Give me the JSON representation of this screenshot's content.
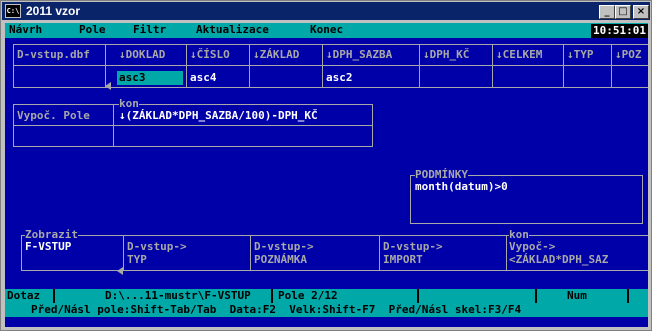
{
  "window": {
    "title": "2011 vzor",
    "icon_text": "C:\\"
  },
  "menu": [
    "Návrh",
    "Pole",
    "Filtr",
    "Aktualizace",
    "Konec"
  ],
  "clock": "10:51:01",
  "table": {
    "name": "D-vstup.dbf",
    "columns": [
      "↓DOKLAD",
      "↓ČÍSLO",
      "↓ZÁKLAD",
      "↓DPH_SAZBA",
      "↓DPH_KČ",
      "↓CELKEM",
      "↓TYP",
      "↓POZ"
    ],
    "values": [
      "asc3",
      "asc4",
      "",
      "asc2",
      "",
      "",
      "",
      ""
    ]
  },
  "calc": {
    "name": "Vypoč. Pole",
    "header": "kon",
    "expression": "↓(ZÁKLAD*DPH_SAZBA/100)-DPH_KČ"
  },
  "conditions": {
    "title": "PODMÍNKY",
    "expression": "month(datum)>0"
  },
  "view": {
    "title": "Zobrazit",
    "fields": [
      {
        "line1": "F-VSTUP",
        "line2": ""
      },
      {
        "line1": "D-vstup->",
        "line2": "TYP"
      },
      {
        "line1": "D-vstup->",
        "line2": "POZNÁMKA"
      },
      {
        "line1": "D-vstup->",
        "line2": "IMPORT"
      },
      {
        "line1": "Vypoč->",
        "line2": "<ZÁKLAD*DPH_SAZ",
        "header": "kon"
      }
    ]
  },
  "status": {
    "mode": "Dotaz",
    "path": "D:\\...11-mustr\\F-VSTUP",
    "field": "Pole 2/12",
    "indicator": "Num"
  },
  "hint": "Před/Násl pole:Shift-Tab/Tab  Data:F2  Velk:Shift-F7  Před/Násl skel:F3/F4",
  "colors": {
    "background": "#0000a8",
    "menu": "#00a8a8",
    "text": "#ffffff",
    "cursor": "#00a8a8"
  }
}
